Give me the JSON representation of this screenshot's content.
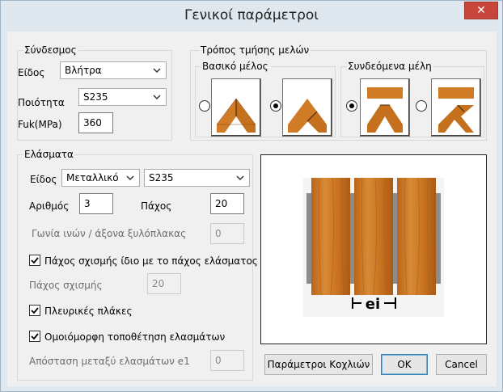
{
  "window": {
    "title": "Γενικοί παράμετροι",
    "close_label": "✕"
  },
  "connection": {
    "group_title": "Σύνδεσμος",
    "type_label": "Είδος",
    "type_value": "Βλήτρα",
    "quality_label": "Ποιότητα",
    "quality_value": "S235",
    "fuk_label": "Fuk(MPa)",
    "fuk_value": "360"
  },
  "cutting": {
    "group_title": "Τρόπος τμήσης μελών",
    "main_member_label": "Βασικό μέλος",
    "connected_members_label": "Συνδεόμενα μέλη",
    "main_option_selected": 2,
    "connected_option_selected": 1
  },
  "plates": {
    "group_title": "Ελάσματα",
    "type_label": "Είδος",
    "type_value": "Μεταλλικό",
    "grade_value": "S235",
    "count_label": "Αριθμός",
    "count_value": "3",
    "thickness_label": "Πάχος",
    "thickness_value": "20",
    "angle_label": "Γωνία ινών / άξονα ξυλόπλακας",
    "angle_value": "0",
    "same_slot_label": "Πάχος σχισμής ίδιο με το πάχος ελάσματος",
    "same_slot_checked": true,
    "slot_thickness_label": "Πάχος σχισμής",
    "slot_thickness_value": "20",
    "side_plates_label": "Πλευρικές πλάκες",
    "side_plates_checked": true,
    "uniform_label": "Ομοιόμορφη τοποθέτηση ελασμάτων",
    "uniform_checked": true,
    "distance_label": "Απόσταση μεταξύ ελασμάτων e1",
    "distance_value": "0"
  },
  "preview": {
    "dimension_label": "ei"
  },
  "buttons": {
    "bolts_label": "Παράμετροι Κοχλιών",
    "ok_label": "OK",
    "cancel_label": "Cancel"
  },
  "colors": {
    "wood": "#c8711f",
    "wood_dark": "#9d5512",
    "steel": "#8c8c8c",
    "accent": "#3c7fb1"
  }
}
